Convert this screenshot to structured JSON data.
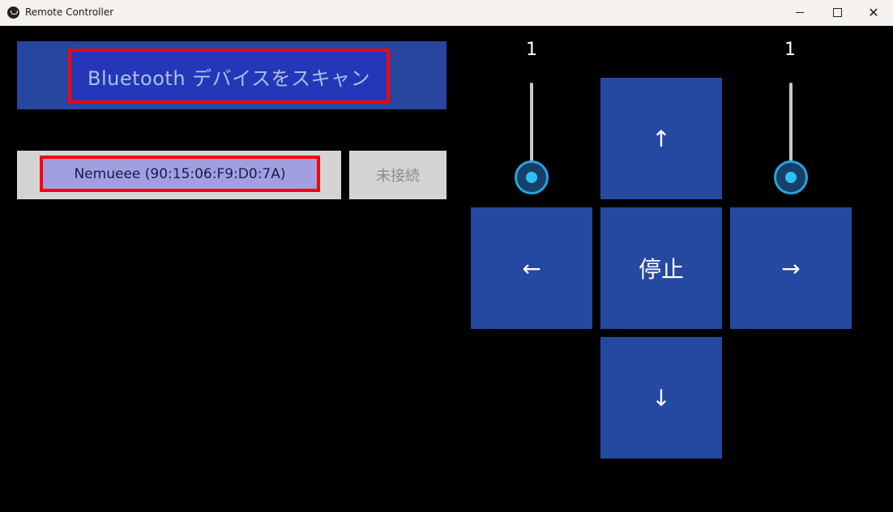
{
  "window": {
    "title": "Remote Controller",
    "minimize_glyph": "—",
    "maximize_glyph": "☐",
    "close_glyph": "✕"
  },
  "bluetooth": {
    "scan_label": "Bluetooth デバイスをスキャン",
    "device_label": "Nemueee (90:15:06:F9:D0:7A)",
    "status_label": "未接続"
  },
  "sliders": {
    "left": {
      "value": "1"
    },
    "right": {
      "value": "1"
    }
  },
  "pad": {
    "up": "↑",
    "left": "←",
    "stop": "停止",
    "right": "→",
    "down": "↓"
  },
  "colors": {
    "accent_blue": "#2548a1",
    "highlight_red": "#ff0000",
    "slider_knob": "#2dc0f0"
  }
}
